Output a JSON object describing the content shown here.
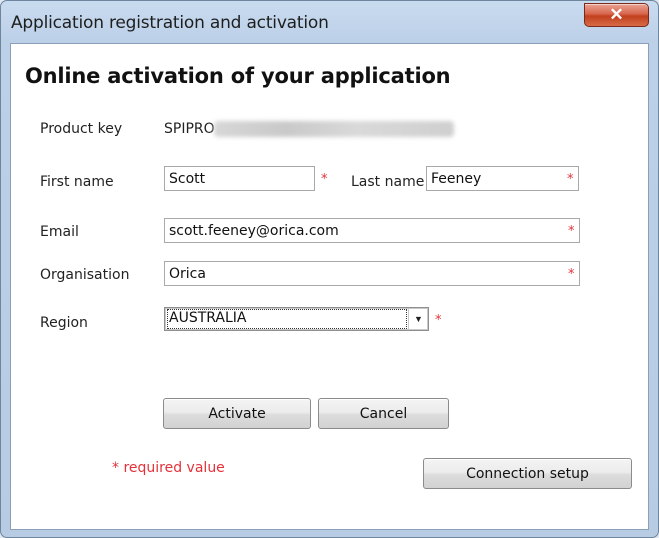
{
  "window": {
    "title": "Application registration and  activation",
    "close_glyph": "✕"
  },
  "form": {
    "heading": "Online activation of your application",
    "product_key_label": "Product key",
    "product_key_value": "SPIPRO",
    "first_name_label": "First name",
    "first_name_value": "Scott",
    "last_name_label": "Last name",
    "last_name_value": "Feeney",
    "email_label": "Email",
    "email_value": "scott.feeney@orica.com",
    "organisation_label": "Organisation",
    "organisation_value": "Orica",
    "region_label": "Region",
    "region_value": "AUSTRALIA",
    "required_marker": "*",
    "required_note": "* required value"
  },
  "buttons": {
    "activate": "Activate",
    "cancel": "Cancel",
    "connection_setup": "Connection setup"
  },
  "icons": {
    "close": "close-icon",
    "dropdown": "chevron-down-icon"
  },
  "colors": {
    "required": "#e4323a",
    "close_button": "#c2401f"
  }
}
